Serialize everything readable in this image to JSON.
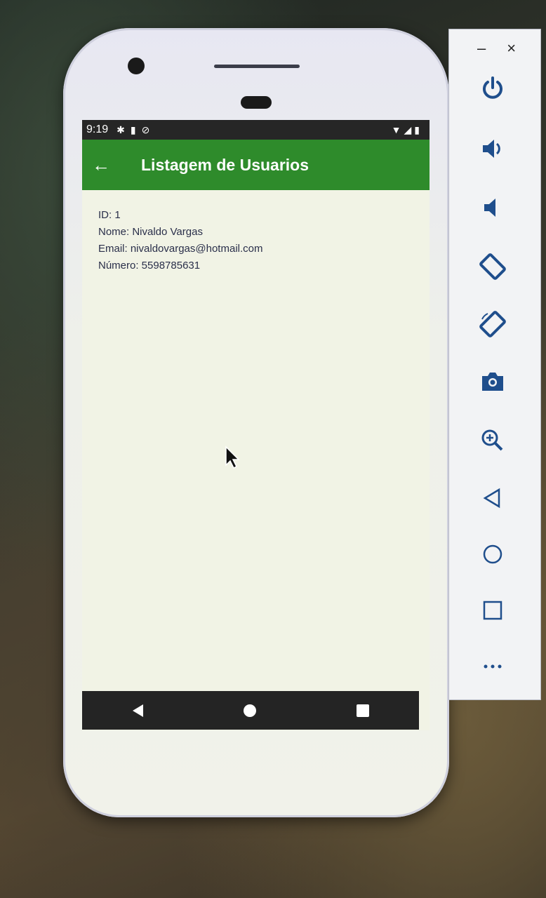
{
  "status_bar": {
    "time": "9:19",
    "left_icons": [
      "settings-icon",
      "sd-card-icon",
      "blocked-icon"
    ],
    "right_icons": [
      "wifi-icon",
      "signal-icon",
      "battery-icon"
    ]
  },
  "app_bar": {
    "back_icon": "arrow-left-icon",
    "title": "Listagem de Usuarios",
    "color": "#2e8b2b"
  },
  "user": {
    "id": "ID: 1",
    "nome": "Nome: Nivaldo Vargas",
    "email": "Email: nivaldovargas@hotmail.com",
    "numero": "Número: 5598785631"
  },
  "nav_bar": {
    "buttons": [
      "back-triangle-icon",
      "home-circle-icon",
      "recents-square-icon"
    ]
  },
  "emulator_toolbar": {
    "window_controls": {
      "minimize": "–",
      "close": "×"
    },
    "tools": [
      "power-icon",
      "volume-up-icon",
      "volume-down-icon",
      "rotate-left-icon",
      "rotate-right-icon",
      "camera-icon",
      "zoom-icon",
      "back-icon",
      "home-icon",
      "overview-icon",
      "more-icon"
    ],
    "accent": "#1f4e8c"
  }
}
